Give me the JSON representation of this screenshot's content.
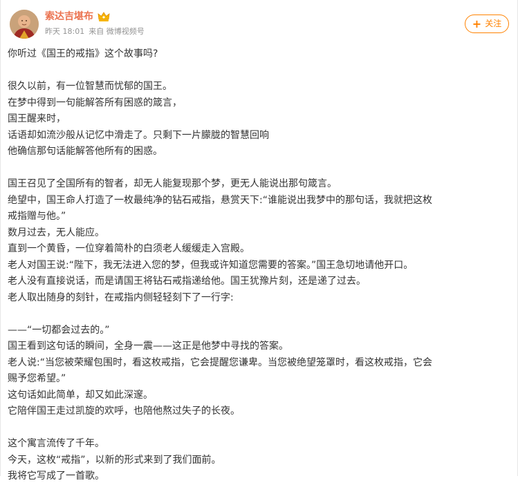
{
  "post": {
    "user_name": "索达吉堪布",
    "badge_icon": "crown-verified-badge-icon",
    "timestamp": "昨天 18:01",
    "source": "来自 微博视频号",
    "follow_label": "关注",
    "lines": [
      "你听过《国王的戒指》这个故事吗?",
      "",
      "很久以前，有一位智慧而忧郁的国王。",
      "在梦中得到一句能解答所有困惑的箴言，",
      "国王醒来时，",
      "话语却如流沙般从记忆中滑走了。只剩下一片朦胧的智慧回响",
      "他确信那句话能解答他所有的困惑。",
      "",
      "国王召见了全国所有的智者，却无人能复现那个梦，更无人能说出那句箴言。",
      "绝望中，国王命人打造了一枚最纯净的钻石戒指，悬赏天下:“谁能说出我梦中的那句话，我就把这枚",
      "戒指赠与他。”",
      "数月过去，无人能应。",
      "直到一个黄昏，一位穿着简朴的白须老人缓缓走入宫殿。",
      "老人对国王说:“陛下，我无法进入您的梦，但我或许知道您需要的答案。”国王急切地请他开口。",
      "老人没有直接说话，而是请国王将钻石戒指递给他。国王犹豫片刻，还是递了过去。",
      "老人取出随身的刻针，在戒指内侧轻轻刻下了一行字:",
      "",
      "——“一切都会过去的。”",
      "国王看到这句话的瞬间，全身一震——这正是他梦中寻找的答案。",
      "老人说:“当您被荣耀包围时，看这枚戒指，它会提醒您谦卑。当您被绝望笼罩时，看这枚戒指，它会",
      "赐予您希望。”",
      "这句话如此简单，却又如此深邃。",
      "它陪伴国王走过凯旋的欢呼，也陪他熬过失子的长夜。",
      "",
      "这个寓言流传了千年。",
      "今天，这枚“戒指”，以新的形式来到了我们面前。",
      "我将它写成了一首歌。"
    ]
  },
  "colors": {
    "name": "#eb7350",
    "follow": "#ff8200",
    "meta": "#939393",
    "text": "#333333"
  }
}
